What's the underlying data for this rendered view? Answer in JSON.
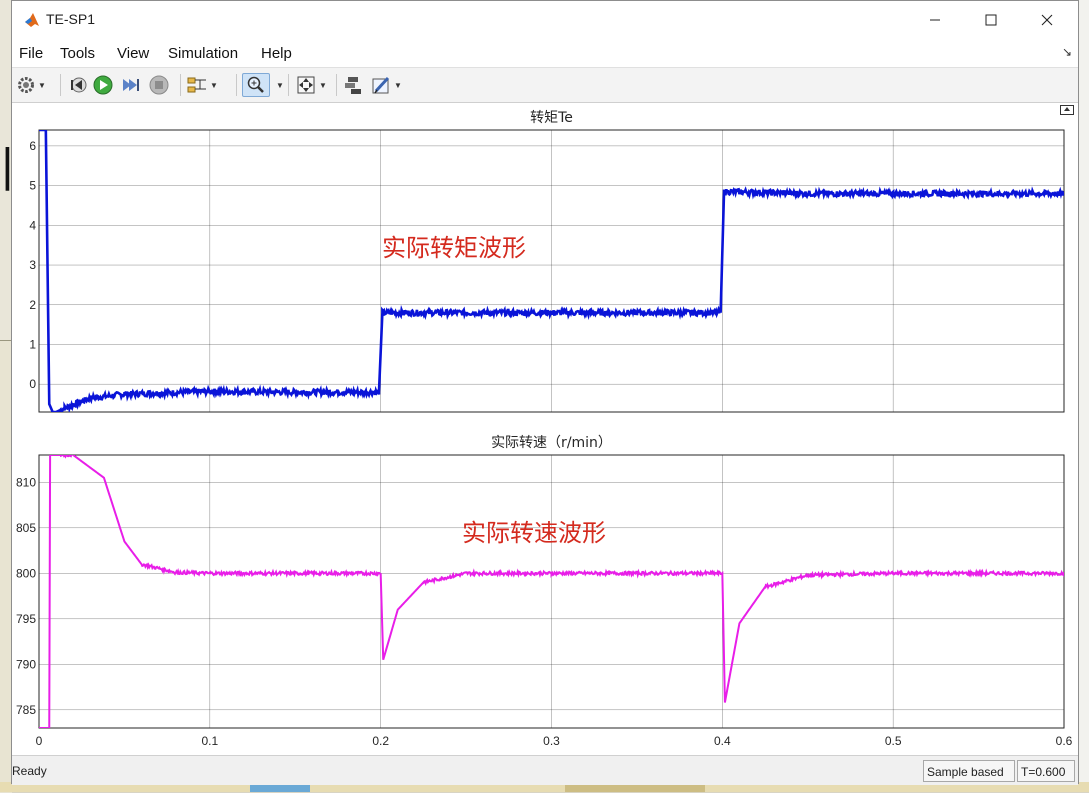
{
  "window": {
    "title": "TE-SP1"
  },
  "menu": [
    {
      "label": "File"
    },
    {
      "label": "Tools"
    },
    {
      "label": "View"
    },
    {
      "label": "Simulation"
    },
    {
      "label": "Help"
    }
  ],
  "toolbar": [
    {
      "name": "settings-icon"
    },
    {
      "name": "step-back-icon"
    },
    {
      "name": "run-icon"
    },
    {
      "name": "step-forward-icon"
    },
    {
      "name": "stop-icon"
    },
    {
      "name": "signal-selector-icon"
    },
    {
      "name": "zoom-icon"
    },
    {
      "name": "fit-to-view-icon"
    },
    {
      "name": "style-icon"
    },
    {
      "name": "edit-icon"
    }
  ],
  "plots": {
    "top": {
      "title": "转矩Te",
      "annotation": "实际转矩波形",
      "yticks": [
        "6",
        "5",
        "4",
        "3",
        "2",
        "1",
        "0"
      ],
      "color": "#0a14d8"
    },
    "bottom": {
      "title": "实际转速（r/min）",
      "annotation": "实际转速波形",
      "yticks": [
        "810",
        "805",
        "800",
        "795",
        "790",
        "785"
      ],
      "color": "#e81ee8"
    },
    "xticks": [
      "0",
      "0.1",
      "0.2",
      "0.3",
      "0.4",
      "0.5",
      "0.6"
    ],
    "annotation_color": "#d42a1e"
  },
  "chart_data": [
    {
      "type": "line",
      "title": "转矩Te",
      "xlim": [
        0,
        0.6
      ],
      "ylim": [
        -0.7,
        6.4
      ],
      "x": [
        0.0,
        0.004,
        0.006,
        0.008,
        0.01,
        0.015,
        0.03,
        0.05,
        0.1,
        0.15,
        0.199,
        0.201,
        0.25,
        0.3,
        0.35,
        0.399,
        0.401,
        0.45,
        0.5,
        0.55,
        0.6
      ],
      "series": [
        {
          "values": [
            6.4,
            6.4,
            -0.5,
            -0.7,
            -0.7,
            -0.6,
            -0.35,
            -0.25,
            -0.18,
            -0.2,
            -0.2,
            1.8,
            1.8,
            1.8,
            1.8,
            1.8,
            4.85,
            4.8,
            4.8,
            4.8,
            4.8
          ]
        }
      ]
    },
    {
      "type": "line",
      "title": "实际转速（r/min）",
      "xlim": [
        0,
        0.6
      ],
      "ylim": [
        783,
        813
      ],
      "x": [
        0.0,
        0.006,
        0.0065,
        0.007,
        0.02,
        0.038,
        0.05,
        0.06,
        0.08,
        0.1,
        0.15,
        0.2,
        0.2015,
        0.21,
        0.225,
        0.25,
        0.3,
        0.4,
        0.4015,
        0.41,
        0.425,
        0.45,
        0.5,
        0.6
      ],
      "series": [
        {
          "values": [
            783,
            783,
            813,
            813,
            813,
            810.5,
            803.5,
            801.0,
            800.1,
            800.0,
            800.0,
            800.0,
            790.5,
            796.0,
            799.0,
            800.0,
            800.0,
            800.0,
            785.8,
            794.5,
            798.5,
            799.8,
            800.0,
            800.0
          ]
        }
      ]
    }
  ],
  "status": {
    "ready": "Ready",
    "mode": "Sample based",
    "time": "T=0.600"
  }
}
